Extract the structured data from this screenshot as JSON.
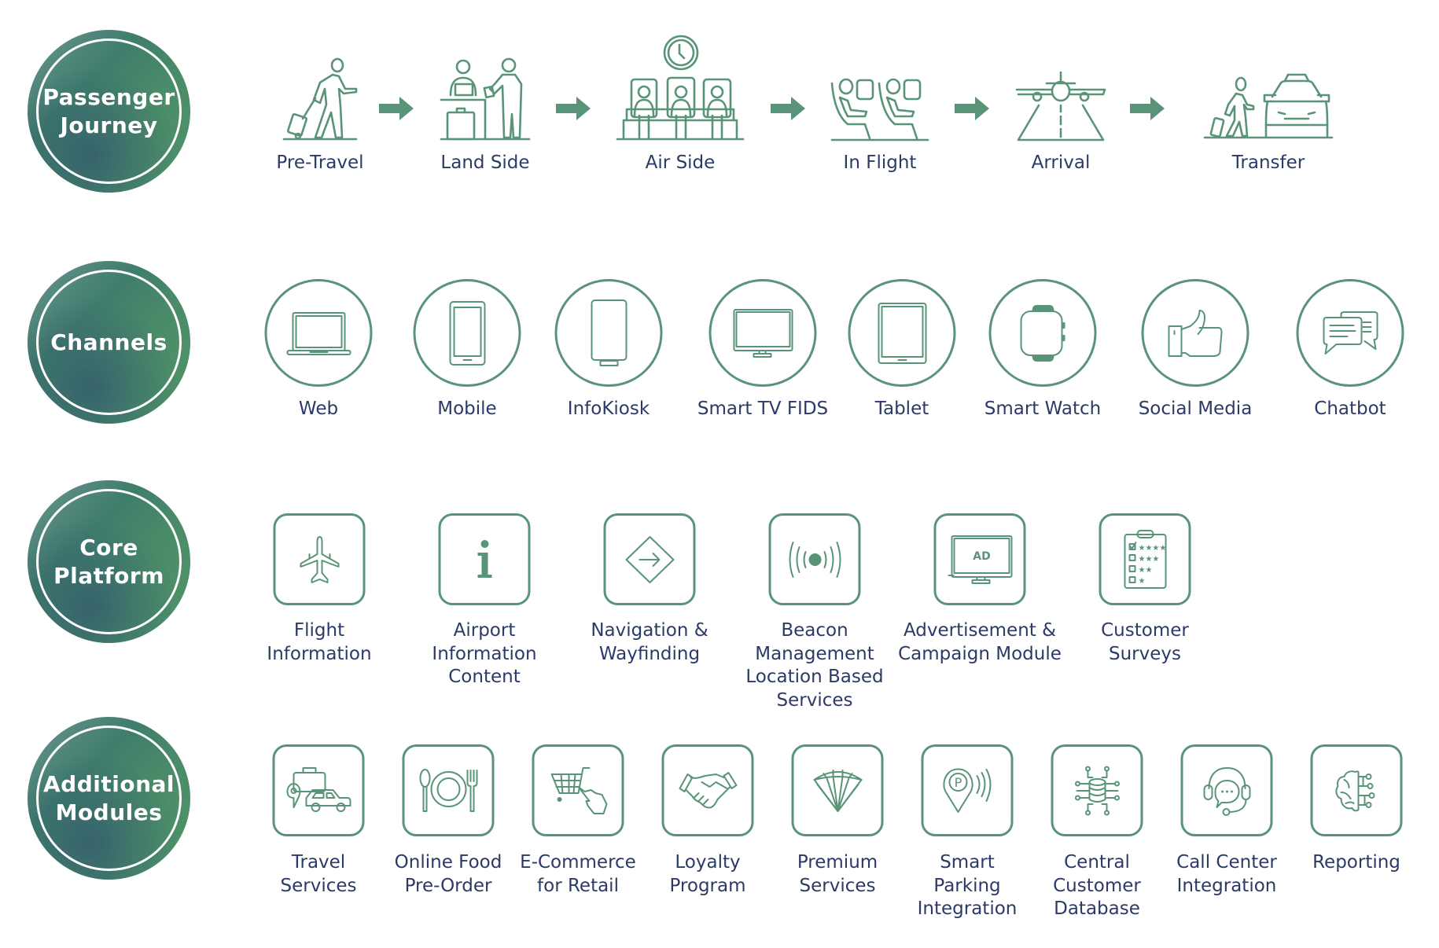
{
  "colors": {
    "accent": "#5a9478",
    "text": "#2b3a67",
    "category_gradient_start": "#9fb3b5",
    "category_gradient_end": "#4f9467"
  },
  "categories": [
    {
      "label": "Passenger\nJourney"
    },
    {
      "label": "Channels"
    },
    {
      "label": "Core\nPlatform"
    },
    {
      "label": "Additional\nModules"
    }
  ],
  "journey": {
    "steps": [
      {
        "label": "Pre-Travel",
        "icon": "traveler-with-luggage-icon"
      },
      {
        "label": "Land Side",
        "icon": "check-in-counter-icon"
      },
      {
        "label": "Air Side",
        "icon": "waiting-lounge-icon"
      },
      {
        "label": "In Flight",
        "icon": "airplane-seats-icon"
      },
      {
        "label": "Arrival",
        "icon": "airplane-landing-icon"
      },
      {
        "label": "Transfer",
        "icon": "taxi-transfer-icon"
      }
    ],
    "connector_icon": "arrow-right-icon"
  },
  "channels": {
    "items": [
      {
        "label": "Web",
        "icon": "laptop-icon"
      },
      {
        "label": "Mobile",
        "icon": "smartphone-icon"
      },
      {
        "label": "InfoKiosk",
        "icon": "kiosk-icon"
      },
      {
        "label": "Smart TV FIDS",
        "icon": "tv-icon"
      },
      {
        "label": "Tablet",
        "icon": "tablet-icon"
      },
      {
        "label": "Smart Watch",
        "icon": "smartwatch-icon"
      },
      {
        "label": "Social Media",
        "icon": "thumbs-up-icon"
      },
      {
        "label": "Chatbot",
        "icon": "chat-bubbles-icon"
      }
    ]
  },
  "core_platform": {
    "items": [
      {
        "label": "Flight\nInformation",
        "icon": "airplane-icon"
      },
      {
        "label": "Airport\nInformation\nContent",
        "icon": "info-icon"
      },
      {
        "label": "Navigation &\nWayfinding",
        "icon": "direction-sign-icon"
      },
      {
        "label": "Beacon\nManagement\nLocation Based\nServices",
        "icon": "beacon-icon"
      },
      {
        "label": "Advertisement &\nCampaign Module",
        "icon": "ad-monitor-icon",
        "icon_text": "AD"
      },
      {
        "label": "Customer\nSurveys",
        "icon": "survey-clipboard-icon"
      }
    ]
  },
  "additional_modules": {
    "items": [
      {
        "label": "Travel\nServices",
        "icon": "travel-car-luggage-icon"
      },
      {
        "label": "Online Food\nPre-Order",
        "icon": "plate-cutlery-icon"
      },
      {
        "label": "E-Commerce\nfor Retail",
        "icon": "shopping-cart-hand-icon"
      },
      {
        "label": "Loyalty\nProgram",
        "icon": "handshake-icon"
      },
      {
        "label": "Premium\nServices",
        "icon": "diamond-icon"
      },
      {
        "label": "Smart\nParking\nIntegration",
        "icon": "parking-pin-icon",
        "icon_text": "P"
      },
      {
        "label": "Central\nCustomer\nDatabase",
        "icon": "database-network-icon"
      },
      {
        "label": "Call Center\nIntegration",
        "icon": "headset-icon"
      },
      {
        "label": "Reporting",
        "icon": "brain-circuit-icon"
      }
    ]
  }
}
